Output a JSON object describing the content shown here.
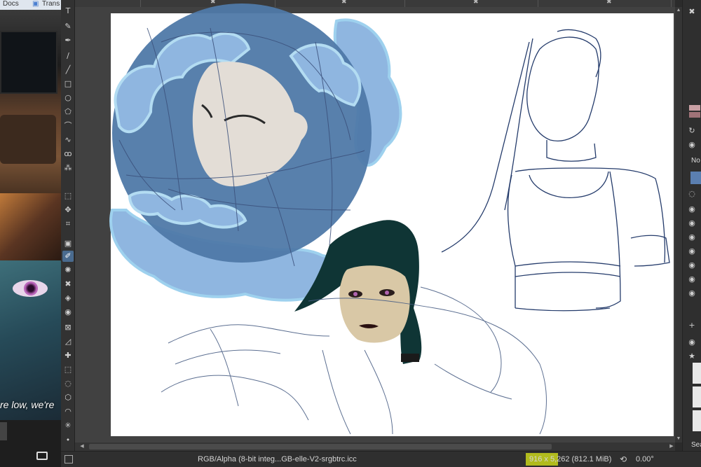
{
  "background_window": {
    "tab1": "Docs",
    "tab2": "Trans",
    "subtitle": "re low, we're"
  },
  "toolbox": {
    "tools": [
      {
        "icon": "text-tool-icon",
        "glyph": "T"
      },
      {
        "icon": "calligraphy-tool-icon",
        "glyph": "✎"
      },
      {
        "icon": "freehand-brush-icon",
        "glyph": "✒"
      },
      {
        "icon": "dynamic-brush-icon",
        "glyph": "∕"
      },
      {
        "icon": "line-tool-icon",
        "glyph": "╱"
      },
      {
        "icon": "rectangle-tool-icon",
        "glyph": "□"
      },
      {
        "icon": "ellipse-tool-icon",
        "glyph": "○"
      },
      {
        "icon": "polygon-tool-icon",
        "glyph": "⬠"
      },
      {
        "icon": "polyline-tool-icon",
        "glyph": "⌒"
      },
      {
        "icon": "bezier-tool-icon",
        "glyph": "∿"
      },
      {
        "icon": "freehand-path-icon",
        "glyph": "ꝏ"
      },
      {
        "icon": "multibrush-icon",
        "glyph": "⁂"
      },
      {
        "icon": "transform-tool-icon",
        "glyph": "⬚"
      },
      {
        "icon": "move-tool-icon",
        "glyph": "✥"
      },
      {
        "icon": "crop-tool-icon",
        "glyph": "⌗"
      },
      {
        "icon": "gradient-tool-icon",
        "glyph": "▣"
      },
      {
        "icon": "color-picker-icon",
        "glyph": "✐"
      },
      {
        "icon": "colorize-mask-icon",
        "glyph": "✺"
      },
      {
        "icon": "smart-patch-icon",
        "glyph": "✖"
      },
      {
        "icon": "fill-tool-icon",
        "glyph": "◈"
      },
      {
        "icon": "enclose-fill-icon",
        "glyph": "◉"
      },
      {
        "icon": "assistant-tool-icon",
        "glyph": "⊠"
      },
      {
        "icon": "measure-tool-icon",
        "glyph": "◿"
      },
      {
        "icon": "reference-tool-icon",
        "glyph": "✚"
      },
      {
        "icon": "rect-select-icon",
        "glyph": "⬚"
      },
      {
        "icon": "ellipse-select-icon",
        "glyph": "◌"
      },
      {
        "icon": "polygon-select-icon",
        "glyph": "⬡"
      },
      {
        "icon": "freehand-select-icon",
        "glyph": "◠"
      },
      {
        "icon": "contiguous-select-icon",
        "glyph": "✳"
      },
      {
        "icon": "similar-select-icon",
        "glyph": "⬩"
      }
    ]
  },
  "docker": {
    "blend_mode_label": "No",
    "search_label": "Sea"
  },
  "statusbar": {
    "color_profile": "RGB/Alpha (8-bit integ...GB-elle-V2-srgbtrc.icc",
    "image_size": "916 x 5,262 (812.1 MiB)",
    "rotation": "0.00°"
  },
  "colors": {
    "canvas_bg": "#414141",
    "paper": "#ffffff",
    "status_highlight": "#c8d41a",
    "sketch_line": "#3a4f7a",
    "fg_color_swatch": "#c9a0a4",
    "layer_selected": "#5b7fb0"
  }
}
